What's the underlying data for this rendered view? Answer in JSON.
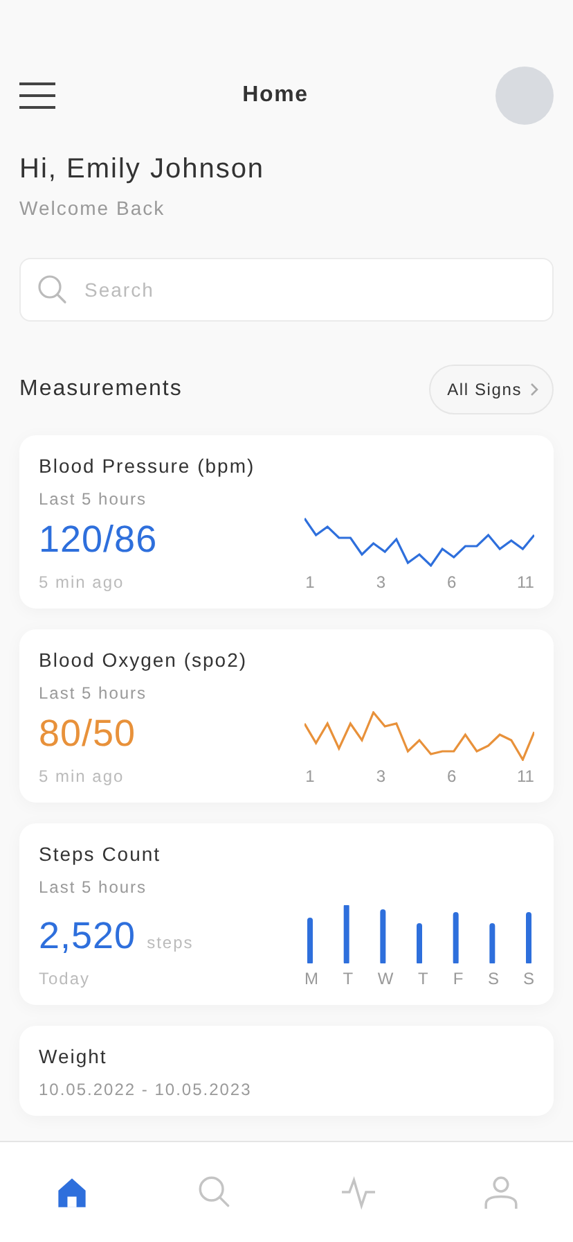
{
  "header": {
    "title": "Home"
  },
  "greeting": {
    "title": "Hi, Emily Johnson",
    "subtitle": "Welcome Back"
  },
  "search": {
    "placeholder": "Search"
  },
  "section": {
    "title": "Measurements",
    "button": "All Signs"
  },
  "cards": [
    {
      "kind": "line",
      "title": "Blood Pressure (bpm)",
      "subtitle": "Last 5 hours",
      "value": "120/86",
      "color": "#2e6fdc",
      "time": "5 min ago",
      "labels": [
        "1",
        "3",
        "6",
        "11"
      ]
    },
    {
      "kind": "line",
      "title": "Blood Oxygen (spo2)",
      "subtitle": "Last 5 hours",
      "value": "80/50",
      "color": "#e8913a",
      "time": "5 min ago",
      "labels": [
        "1",
        "3",
        "6",
        "11"
      ]
    },
    {
      "kind": "bars",
      "title": "Steps Count",
      "subtitle": "Last 5 hours",
      "value": "2,520",
      "unit": "steps",
      "color": "#2e6fdc",
      "time": "Today",
      "labels": [
        "M",
        "T",
        "W",
        "T",
        "F",
        "S",
        "S"
      ]
    },
    {
      "kind": "summary",
      "title": "Weight",
      "subtitle": "10.05.2022 - 10.05.2023"
    }
  ],
  "nav": [
    {
      "kind": "home",
      "selected": true
    },
    {
      "kind": "search",
      "selected": false
    },
    {
      "kind": "activity",
      "selected": false
    },
    {
      "kind": "profile",
      "selected": false
    }
  ]
}
